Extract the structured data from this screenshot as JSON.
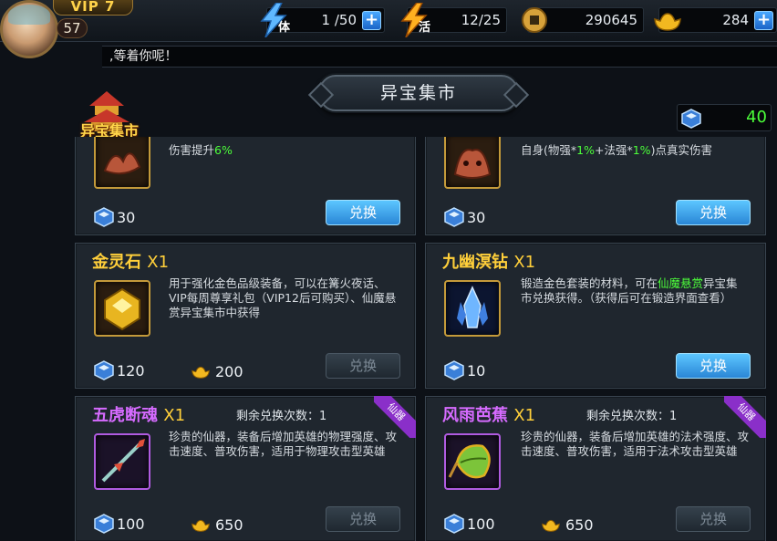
{
  "player": {
    "vip": "VIP 7",
    "level": "57"
  },
  "resources": {
    "stamina": {
      "icon_text": "体",
      "value": "1 /50"
    },
    "vitality": {
      "icon_text": "活",
      "value": "12/25"
    },
    "coins": {
      "value": "290645"
    },
    "ingots": {
      "value": "284"
    }
  },
  "notice": ",等着你呢！",
  "shop": {
    "title": "异宝集市",
    "icon_label": "异宝集市",
    "gem_balance": "40"
  },
  "cards": [
    {
      "desc_a": "伤害提升",
      "desc_b": "6%",
      "gem": "30",
      "button": "兑换"
    },
    {
      "desc_a": "自身(物强*",
      "desc_b": "1%",
      "desc_c": "+法强*",
      "desc_d": "1%",
      "desc_e": ")点真实伤害",
      "gem": "30",
      "button": "兑换"
    },
    {
      "name": "金灵石",
      "qty": "X1",
      "desc": "用于强化金色品级装备，可以在篝火夜话、VIP每周尊享礼包（VIP12后可购买）、仙魔悬赏异宝集市中获得",
      "gem": "120",
      "gold": "200",
      "button": "兑换"
    },
    {
      "name": "九幽溟钻",
      "qty": "X1",
      "desc_a": "锻造金色套装的材料，可在",
      "desc_b": "仙魔悬赏",
      "desc_c": "异宝集市兑换获得。（获得后可在锻造界面查看）",
      "gem": "10",
      "button": "兑换"
    },
    {
      "name": "五虎断魂",
      "qty": "X1",
      "remain": "剩余兑换次数：1",
      "ribbon": "仙器",
      "desc": "珍贵的仙器，装备后增加英雄的物理强度、攻击速度、普攻伤害，适用于物理攻击型英雄",
      "gem": "100",
      "gold": "650",
      "button": "兑换"
    },
    {
      "name": "风雨芭蕉",
      "qty": "X1",
      "remain": "剩余兑换次数：1",
      "ribbon": "仙器",
      "desc": "珍贵的仙器，装备后增加英雄的法术强度、攻击速度、普攻伤害，适用于法术攻击型英雄",
      "gem": "100",
      "gold": "650",
      "button": "兑换"
    }
  ],
  "colors": {
    "gold_text": "#ffcf3a",
    "purple_text": "#d66bff",
    "green_text": "#4cff3a",
    "button_blue": "#2a86d6"
  }
}
